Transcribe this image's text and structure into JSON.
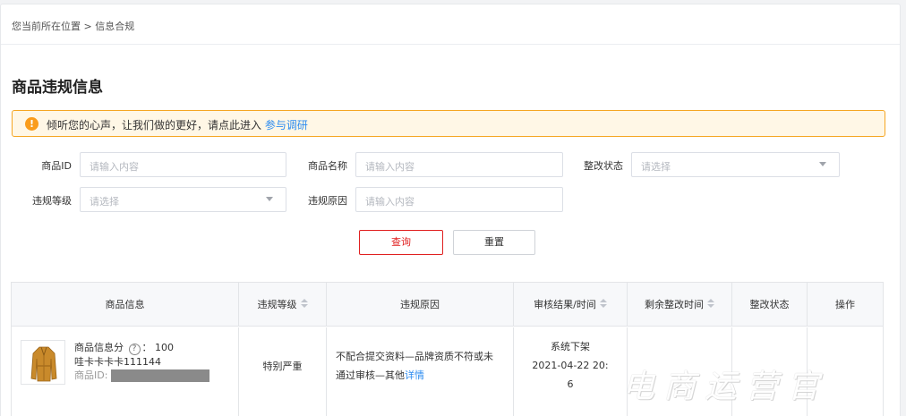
{
  "breadcrumb": "您当前所在位置 > 信息合规",
  "page_title": "商品违规信息",
  "notice": {
    "icon": "warning-icon",
    "text": "倾听您的心声，让我们做的更好，请点此进入",
    "link": "参与调研"
  },
  "filters": {
    "product_id": {
      "label": "商品ID",
      "placeholder": "请输入内容"
    },
    "product_name": {
      "label": "商品名称",
      "placeholder": "请输入内容"
    },
    "fix_status": {
      "label": "整改状态",
      "placeholder": "请选择"
    },
    "violation_level": {
      "label": "违规等级",
      "placeholder": "请选择"
    },
    "violation_reason": {
      "label": "违规原因",
      "placeholder": "请输入内容"
    }
  },
  "buttons": {
    "query": "查询",
    "reset": "重置"
  },
  "table": {
    "headers": {
      "product_info": "商品信息",
      "level": "违规等级",
      "reason": "违规原因",
      "audit": "审核结果/时间",
      "remaining": "剩余整改时间",
      "status": "整改状态",
      "action": "操作"
    },
    "rows": [
      {
        "score_label": "商品信息分",
        "score_sep": "：",
        "score": "100",
        "name": "哇卡卡卡卡111144",
        "id_label": "商品ID:",
        "level": "特别严重",
        "reason_line1": "不配合提交资料—品牌资质不符或未",
        "reason_line2": "通过审核—其他",
        "reason_link": "详情",
        "audit_result": "系统下架",
        "audit_time": "2021-04-22 20:",
        "audit_time_tail": "6"
      }
    ]
  },
  "watermark": "电商运营官"
}
